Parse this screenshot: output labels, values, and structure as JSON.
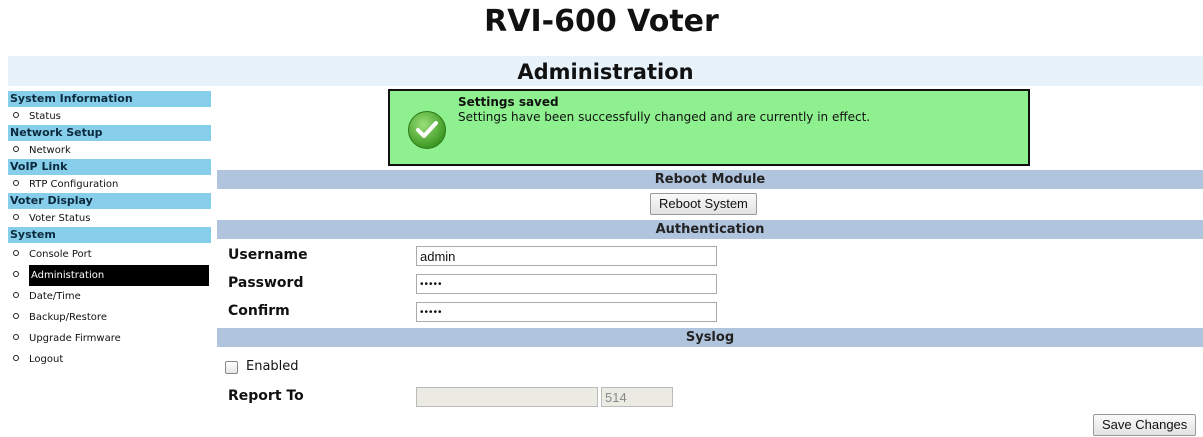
{
  "app_title": "RVI-600 Voter",
  "page_title": "Administration",
  "sidebar": {
    "sections": [
      {
        "header": "System Information",
        "items": [
          {
            "label": "Status"
          }
        ]
      },
      {
        "header": "Network Setup",
        "items": [
          {
            "label": "Network"
          }
        ]
      },
      {
        "header": "VoIP Link",
        "items": [
          {
            "label": "RTP Configuration"
          }
        ]
      },
      {
        "header": "Voter Display",
        "items": [
          {
            "label": "Voter Status"
          }
        ]
      },
      {
        "header": "System",
        "items": [
          {
            "label": "Console Port"
          },
          {
            "label": "Administration",
            "active": true
          },
          {
            "label": "Date/Time"
          },
          {
            "label": "Backup/Restore"
          },
          {
            "label": "Upgrade Firmware"
          },
          {
            "label": "Logout"
          }
        ]
      }
    ]
  },
  "notice": {
    "icon": "checkmark-icon",
    "title": "Settings saved",
    "text": "Settings have been successfully changed and are currently in effect.",
    "bg_color": "#8ef08e"
  },
  "reboot": {
    "section_title": "Reboot Module",
    "button_label": "Reboot System"
  },
  "auth": {
    "section_title": "Authentication",
    "username_label": "Username",
    "username_value": "admin",
    "password_label": "Password",
    "password_value": "•••••",
    "confirm_label": "Confirm",
    "confirm_value": "•••••"
  },
  "syslog": {
    "section_title": "Syslog",
    "enabled_label": "Enabled",
    "enabled_checked": false,
    "report_to_label": "Report To",
    "report_to_value": "",
    "port_value": "514"
  },
  "save_button_label": "Save Changes",
  "colors": {
    "sidebar_header": "#87ceeb",
    "section_bar": "#b0c4de",
    "active_item": "#000000"
  }
}
